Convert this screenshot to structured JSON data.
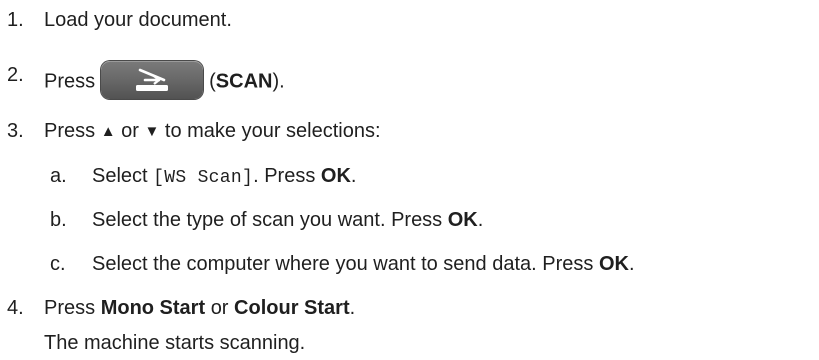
{
  "steps": [
    {
      "num": "1.",
      "text": "Load your document."
    },
    {
      "num": "2.",
      "pre": "Press",
      "button_icon": "scan-icon",
      "paren_open": "(",
      "bold": "SCAN",
      "paren_close": ")."
    },
    {
      "num": "3.",
      "pre": "Press",
      "up_glyph": "▲",
      "mid": "or",
      "down_glyph": "▼",
      "post": "to make your selections:"
    },
    {
      "num": "4.",
      "pre": "Press",
      "bold1": "Mono Start",
      "mid": "or",
      "bold2": "Colour Start",
      "post": "."
    }
  ],
  "substeps": [
    {
      "letter": "a.",
      "pre": "Select",
      "mono": "[WS Scan]",
      "mid": ". Press",
      "bold": "OK",
      "post": "."
    },
    {
      "letter": "b.",
      "pre": "Select the type of scan you want. Press",
      "bold": "OK",
      "post": "."
    },
    {
      "letter": "c.",
      "pre": "Select the computer where you want to send data. Press",
      "bold": "OK",
      "post": "."
    }
  ],
  "result_note": "The machine starts scanning.",
  "colors": {
    "text": "#1f1f1f",
    "button": "#6a6a6a",
    "button_icon": "#ffffff"
  }
}
